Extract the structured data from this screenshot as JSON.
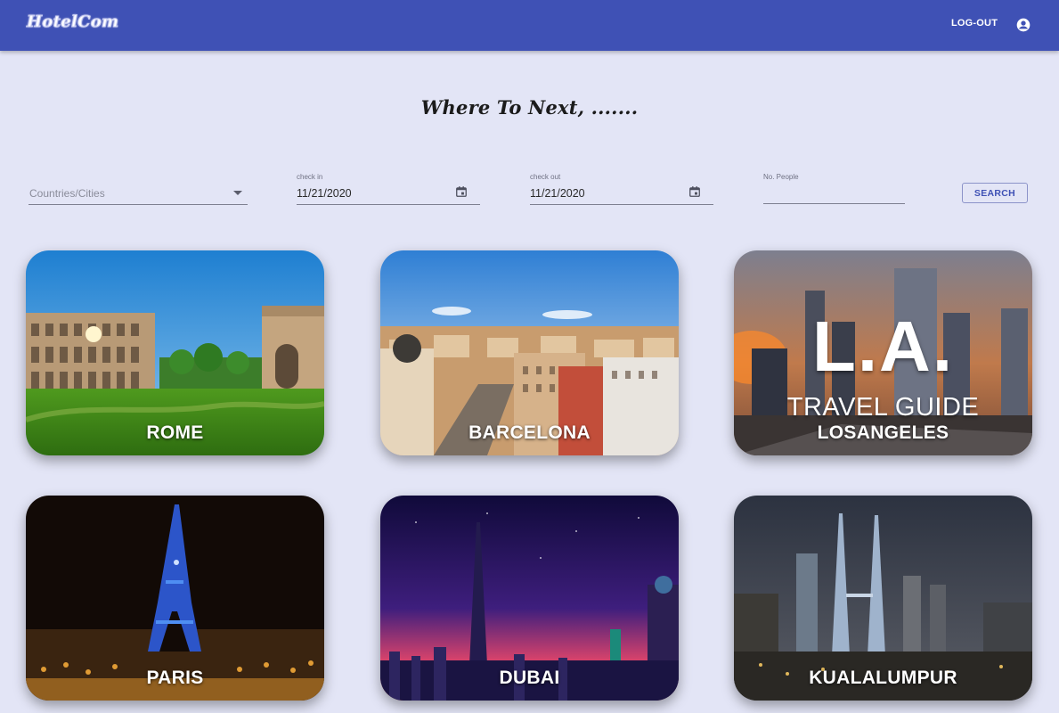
{
  "app": {
    "logo": "HotelCom",
    "logout_label": "LOG-OUT"
  },
  "headline": "Where To Next, .......",
  "search": {
    "destination": {
      "placeholder": "Countries/Cities"
    },
    "check_in": {
      "label": "check in",
      "value": "11/21/2020"
    },
    "check_out": {
      "label": "check out",
      "value": "11/21/2020"
    },
    "people": {
      "label": "No. People",
      "value": ""
    },
    "button_label": "SEARCH"
  },
  "destinations": [
    {
      "label": "ROME"
    },
    {
      "label": "BARCELONA"
    },
    {
      "label": "LOSANGELES",
      "overlay_title": "L.A.",
      "overlay_subtitle": "TRAVEL GUIDE"
    },
    {
      "label": "PARIS"
    },
    {
      "label": "DUBAI"
    },
    {
      "label": "KUALALUMPUR"
    }
  ],
  "colors": {
    "appbar": "#3f51b5",
    "background": "#e3e5f6",
    "accent": "#3f51b5"
  },
  "icons": {
    "account": "account-circle-icon",
    "dropdown": "caret-down-icon",
    "calendar": "calendar-icon"
  }
}
